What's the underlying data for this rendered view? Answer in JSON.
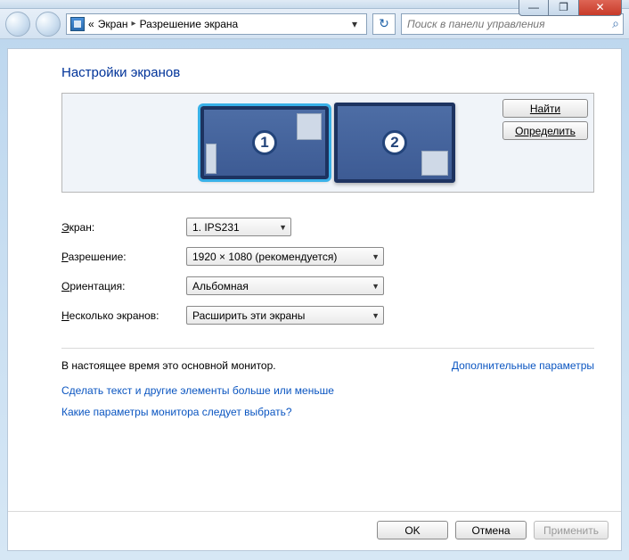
{
  "win": {
    "min_glyph": "—",
    "max_glyph": "❐",
    "close_glyph": "✕"
  },
  "nav": {
    "back_glyph": "",
    "fwd_glyph": "",
    "crumb_prefix": "«",
    "crumb1": "Экран",
    "crumb_sep": "▸",
    "crumb2": "Разрешение экрана",
    "drop_glyph": "▾",
    "refresh_glyph": "↻",
    "search_placeholder": "Поиск в панели управления",
    "search_glyph": "⌕"
  },
  "heading": "Настройки экранов",
  "monitors": {
    "m1_num": "1",
    "m2_num": "2"
  },
  "buttons": {
    "find": "Найти",
    "identify": "Определить"
  },
  "form": {
    "display_label_pre": "",
    "display_label_u": "Э",
    "display_label_post": "кран:",
    "display_value": "1. IPS231",
    "res_label_pre": "",
    "res_label_u": "Р",
    "res_label_post": "азрешение:",
    "res_value": "1920 × 1080 (рекомендуется)",
    "orient_label_pre": "",
    "orient_label_u": "О",
    "orient_label_post": "риентация:",
    "orient_value": "Альбомная",
    "multi_label_pre": "",
    "multi_label_u": "Н",
    "multi_label_post": "есколько экранов:",
    "multi_value": "Расширить эти экраны"
  },
  "status": "В настоящее время это основной монитор.",
  "advanced_link": "Дополнительные параметры",
  "link1": "Сделать текст и другие элементы больше или меньше",
  "link2": "Какие параметры монитора следует выбрать?",
  "footer": {
    "ok": "OK",
    "cancel": "Отмена",
    "apply": "Применить"
  }
}
